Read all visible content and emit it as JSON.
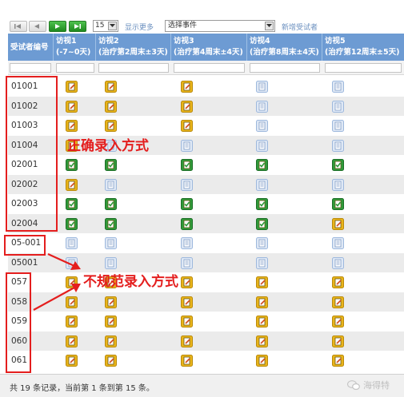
{
  "toolbar": {
    "page_size": "15",
    "show_more": "显示更多",
    "event_select": "选择事件",
    "add_subject": "新增受试者"
  },
  "table": {
    "headers": [
      {
        "line1": "受试者编号",
        "line2": ""
      },
      {
        "line1": "访视1",
        "line2": "(-7~0天)"
      },
      {
        "line1": "访视2",
        "line2": "(治疗第2周末±3天)"
      },
      {
        "line1": "访视3",
        "line2": "(治疗第4周末±4天)"
      },
      {
        "line1": "访视4",
        "line2": "(治疗第8周末±4天)"
      },
      {
        "line1": "访视5",
        "line2": "(治疗第12周末±5天)"
      }
    ],
    "rows": [
      {
        "id": "01001",
        "status": [
          "yellow",
          "yellow",
          "yellow",
          "blue",
          "blue"
        ]
      },
      {
        "id": "01002",
        "status": [
          "yellow",
          "yellow",
          "yellow",
          "blue",
          "blue"
        ]
      },
      {
        "id": "01003",
        "status": [
          "yellow",
          "yellow",
          "yellow",
          "blue",
          "blue"
        ]
      },
      {
        "id": "01004",
        "status": [
          "yellow",
          "blue",
          "blue",
          "blue",
          "blue"
        ]
      },
      {
        "id": "02001",
        "status": [
          "green",
          "green",
          "green",
          "green",
          "green"
        ]
      },
      {
        "id": "02002",
        "status": [
          "yellow",
          "blue",
          "blue",
          "blue",
          "blue"
        ]
      },
      {
        "id": "02003",
        "status": [
          "green",
          "green",
          "green",
          "green",
          "green"
        ]
      },
      {
        "id": "02004",
        "status": [
          "green",
          "green",
          "green",
          "green",
          "yellow"
        ]
      },
      {
        "id": "05-001",
        "status": [
          "blue",
          "blue",
          "blue",
          "blue",
          "blue"
        ]
      },
      {
        "id": "05001",
        "status": [
          "blue",
          "blue",
          "blue",
          "blue",
          "blue"
        ]
      },
      {
        "id": "057",
        "status": [
          "yellow",
          "yellow",
          "yellow",
          "yellow",
          "yellow"
        ]
      },
      {
        "id": "058",
        "status": [
          "yellow",
          "yellow",
          "yellow",
          "yellow",
          "yellow"
        ]
      },
      {
        "id": "059",
        "status": [
          "yellow",
          "yellow",
          "yellow",
          "yellow",
          "yellow"
        ]
      },
      {
        "id": "060",
        "status": [
          "yellow",
          "yellow",
          "yellow",
          "yellow",
          "yellow"
        ]
      },
      {
        "id": "061",
        "status": [
          "yellow",
          "yellow",
          "yellow",
          "yellow",
          "yellow"
        ]
      }
    ]
  },
  "footer": {
    "summary": "共 19 条记录，当前第 1 条到第 15 条。",
    "brand": "海得特"
  },
  "annotations": {
    "correct": "正确录入方式",
    "incorrect": "不规范录入方式"
  },
  "colors": {
    "header_bg": "#6d9bd3",
    "annotation_red": "#e41e1e",
    "status_yellow": "#e9b41a",
    "status_blue": "#9db8dd",
    "status_green": "#2f9a3a"
  },
  "icons": {
    "first_page": "first-page-icon",
    "prev_page": "prev-page-icon",
    "next_page": "next-page-icon",
    "last_page": "last-page-icon",
    "dropdown": "chevron-down-icon",
    "brand": "chat-bubble-icon"
  }
}
